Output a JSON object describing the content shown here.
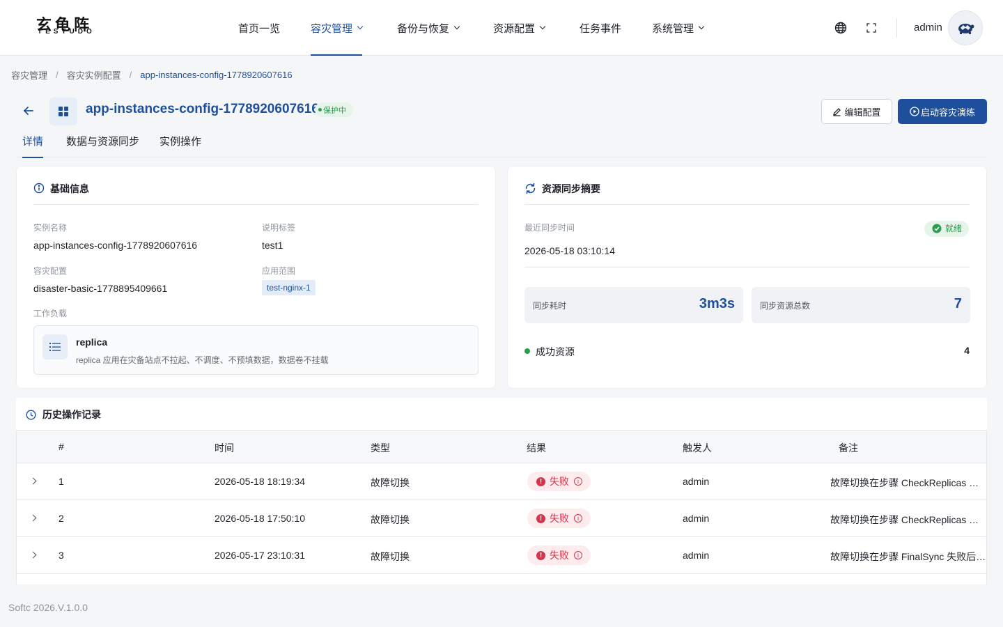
{
  "brand": {
    "logo_cn": "玄龟阵",
    "logo_en": "TESTUDO"
  },
  "nav": {
    "items": [
      {
        "label": "首页一览",
        "dropdown": false,
        "active": false
      },
      {
        "label": "容灾管理",
        "dropdown": true,
        "active": true
      },
      {
        "label": "备份与恢复",
        "dropdown": true,
        "active": false
      },
      {
        "label": "资源配置",
        "dropdown": true,
        "active": false
      },
      {
        "label": "任务事件",
        "dropdown": false,
        "active": false
      },
      {
        "label": "系统管理",
        "dropdown": true,
        "active": false
      }
    ],
    "user": "admin"
  },
  "breadcrumb": [
    "容灾管理",
    "容灾实例配置",
    "app-instances-config-1778920607616"
  ],
  "header": {
    "title": "app-instances-config-1778920607616",
    "status": "保护中",
    "edit_button": "编辑配置",
    "start_button": "启动容灾演练"
  },
  "tabs": [
    "详情",
    "数据与资源同步",
    "实例操作"
  ],
  "basic_info": {
    "title": "基础信息",
    "instance_name_label": "实例名称",
    "instance_name": "app-instances-config-1778920607616",
    "desc_label": "说明标签",
    "desc": "test1",
    "config_label": "容灾配置",
    "config": "disaster-basic-1778895409661",
    "scope_label": "应用范围",
    "scope_tag": "test-nginx-1",
    "workload_label": "工作负载",
    "workload_name": "replica",
    "workload_desc": "replica 应用在灾备站点不拉起、不调度、不预填数据，数据卷不挂载"
  },
  "sync_summary": {
    "title": "资源同步摘要",
    "last_sync_label": "最近同步时间",
    "last_sync": "2026-05-18 03:10:14",
    "status": "就绪",
    "duration_label": "同步耗时",
    "duration": "3m3s",
    "total_label": "同步资源总数",
    "total": "7",
    "success_label": "成功资源",
    "success": "4"
  },
  "history": {
    "title": "历史操作记录",
    "columns": [
      "#",
      "时间",
      "类型",
      "结果",
      "触发人",
      "备注"
    ],
    "rows": [
      {
        "no": "1",
        "time": "2026-05-18 18:19:34",
        "type": "故障切换",
        "result": "失败",
        "user": "admin",
        "remark": "故障切换在步骤 CheckReplicas 失败后回滚"
      },
      {
        "no": "2",
        "time": "2026-05-18 17:50:10",
        "type": "故障切换",
        "result": "失败",
        "user": "admin",
        "remark": "故障切换在步骤 CheckReplicas 失败后回滚"
      },
      {
        "no": "3",
        "time": "2026-05-17 23:10:31",
        "type": "故障切换",
        "result": "失败",
        "user": "admin",
        "remark": "故障切换在步骤 FinalSync 失败后回滚"
      }
    ]
  },
  "footer": "Softc 2026.V.1.0.0",
  "colors": {
    "primary": "#1e4f9c",
    "success": "#2a9d4f",
    "danger": "#d4354b"
  }
}
